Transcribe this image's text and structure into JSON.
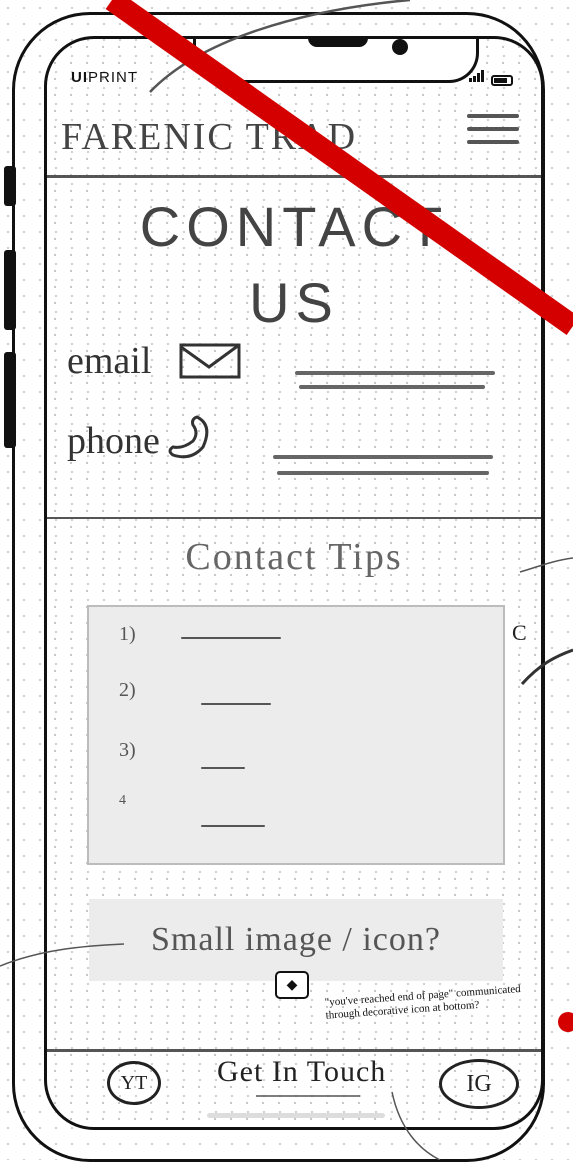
{
  "brand": {
    "bold": "UI",
    "rest": "PRINT"
  },
  "header": {
    "title": "FARENIC TRAD"
  },
  "contact": {
    "heading_line1": "CONTACT",
    "heading_line2": "US",
    "email_label": "email",
    "phone_label": "phone"
  },
  "tips": {
    "title": "Contact Tips",
    "items": [
      {
        "num": "1)"
      },
      {
        "num": "2)"
      },
      {
        "num": "3)"
      },
      {
        "num": "4"
      }
    ]
  },
  "image_area": {
    "label": "Small image / icon?"
  },
  "annotation": {
    "note": "\"you've reached end of page\" communicated through decorative icon at bottom?",
    "side_letter": "C"
  },
  "footer": {
    "left_icon": "YT",
    "center_label": "Get In Touch",
    "right_icon": "IG"
  },
  "colors": {
    "strike": "#d40000",
    "ink": "#333333",
    "panel": "#ececec"
  }
}
